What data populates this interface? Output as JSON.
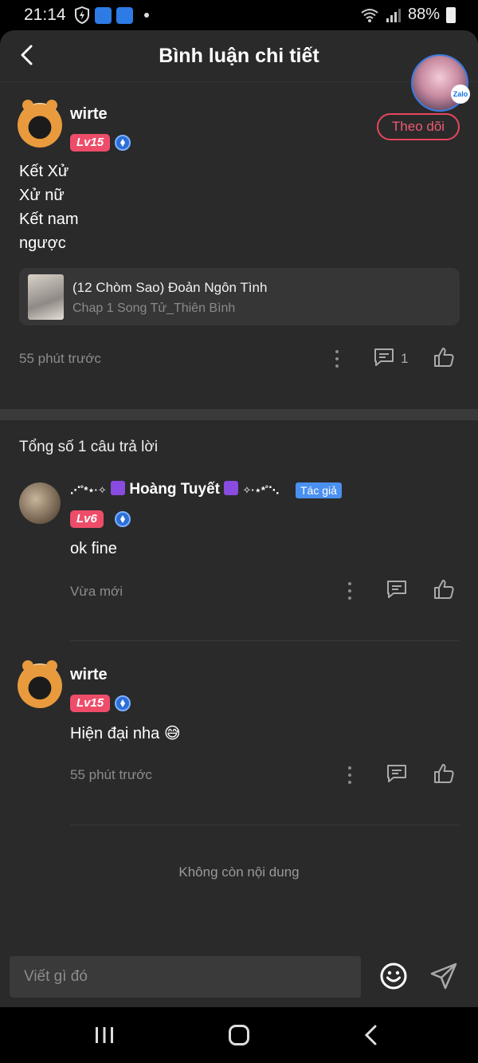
{
  "status_bar": {
    "time": "21:14",
    "battery": "88%",
    "icons": [
      "shield-icon",
      "novel-toon-icon",
      "app-icon",
      "wifi-icon",
      "signal-icon",
      "battery-icon"
    ]
  },
  "header": {
    "title": "Bình luận chi tiết",
    "back_icon": "chevron-left-icon"
  },
  "zalo_bubble": {
    "badge": "Zalo"
  },
  "main_comment": {
    "username": "wirte",
    "level": "Lv15",
    "follow_label": "Theo dõi",
    "lines": [
      "Kết Xử",
      "Xử nữ",
      "Kết nam",
      "ngược"
    ],
    "story": {
      "title": "(12 Chòm Sao) Đoản Ngôn Tình",
      "chapter": "Chap 1 Song Tử_Thiên Bình"
    },
    "time": "55 phút trước",
    "reply_count": "1"
  },
  "replies_section": {
    "total_label": "Tổng số 1 câu trả lời",
    "replies": [
      {
        "prefix": "⋰˚*⋆·✧",
        "name": "Hoàng Tuyết",
        "suffix": "✧·⋆*˚⋱",
        "author_tag": "Tác giả",
        "level": "Lv6",
        "text": "ok fine",
        "time": "Vừa mới"
      },
      {
        "name": "wirte",
        "level": "Lv15",
        "text": "Hiện đại nha 😅",
        "time": "55 phút trước"
      }
    ],
    "no_more": "Không còn nội dung"
  },
  "composer": {
    "placeholder": "Viết gì đó"
  },
  "colors": {
    "background": "#2a2a2a",
    "accent_pink": "#ee4d6a",
    "author_tag_blue": "#4a90f0"
  }
}
